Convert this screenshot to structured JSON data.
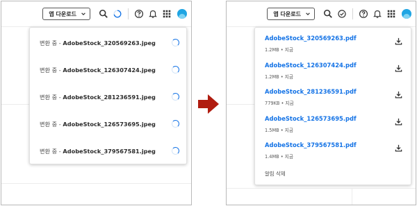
{
  "colors": {
    "accent": "#1473e6",
    "arrow": "#b01c10",
    "avatar": "#1fa5e3"
  },
  "left": {
    "download_button": "앱 다운로드",
    "top_icons": [
      "search-icon",
      "loading-spinner-icon",
      "help-icon",
      "bell-icon",
      "app-grid-icon",
      "avatar"
    ],
    "items": [
      {
        "status": "변환 중 - ",
        "filename": "AdobeStock_320569263.jpeg"
      },
      {
        "status": "변환 중 - ",
        "filename": "AdobeStock_126307424.jpeg"
      },
      {
        "status": "변환 중 - ",
        "filename": "AdobeStock_281236591.jpeg"
      },
      {
        "status": "변환 중 - ",
        "filename": "AdobeStock_126573695.jpeg"
      },
      {
        "status": "변환 중 - ",
        "filename": "AdobeStock_379567581.jpeg"
      }
    ]
  },
  "right": {
    "download_button": "앱 다운로드",
    "top_icons": [
      "search-icon",
      "check-circle-icon",
      "help-icon",
      "bell-icon",
      "app-grid-icon",
      "avatar"
    ],
    "items": [
      {
        "filename": "AdobeStock_320569263.pdf",
        "meta": "1.2MB • 지금"
      },
      {
        "filename": "AdobeStock_126307424.pdf",
        "meta": "1.2MB • 지금"
      },
      {
        "filename": "AdobeStock_281236591.pdf",
        "meta": "779KB • 지금"
      },
      {
        "filename": "AdobeStock_126573695.pdf",
        "meta": "1.5MB • 지금"
      },
      {
        "filename": "AdobeStock_379567581.pdf",
        "meta": "1.4MB • 지금"
      }
    ],
    "clear_label": "알림 삭제"
  }
}
